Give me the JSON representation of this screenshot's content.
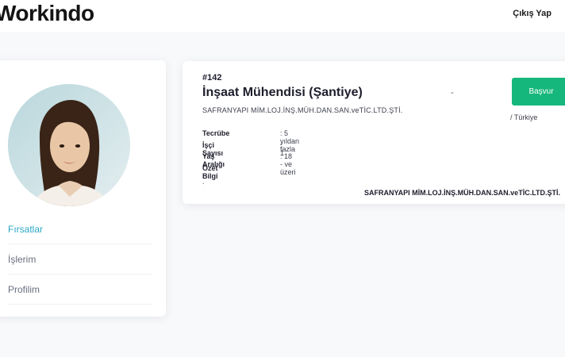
{
  "header": {
    "logo_text": "Workindo",
    "logout_label": "Çıkış Yap"
  },
  "sidebar": {
    "avatar_alt": "profile photo",
    "items": [
      {
        "label": "Fırsatlar",
        "active": true
      },
      {
        "label": "İşlerim",
        "active": false
      },
      {
        "label": "Profilim",
        "active": false
      }
    ]
  },
  "job": {
    "id": "#142",
    "title": "İnşaat Mühendisi (Şantiye)",
    "company": "SAFRANYAPI MİM.LOJ.İNŞ.MÜH.DAN.SAN.veTİC.LTD.ŞTİ.",
    "dash": "-",
    "apply_label": "Başvur",
    "location": "/ Türkiye",
    "details": [
      {
        "label": "Tecrübe",
        "value": ": 5 yıldan fazla"
      },
      {
        "label": "İşçi Sayısı",
        "value": ": 1"
      },
      {
        "label": "Yaş Aralığı",
        "value": ": 18 - ve üzeri"
      },
      {
        "label": "Özet Bilgi",
        "value": ""
      }
    ],
    "summary_text": ".",
    "footer_company": "SAFRANYAPI MİM.LOJ.İNŞ.MÜH.DAN.SAN.veTİC.LTD.ŞTİ."
  },
  "colors": {
    "accent": "#2aa7c5",
    "apply_button": "#16b77c"
  }
}
